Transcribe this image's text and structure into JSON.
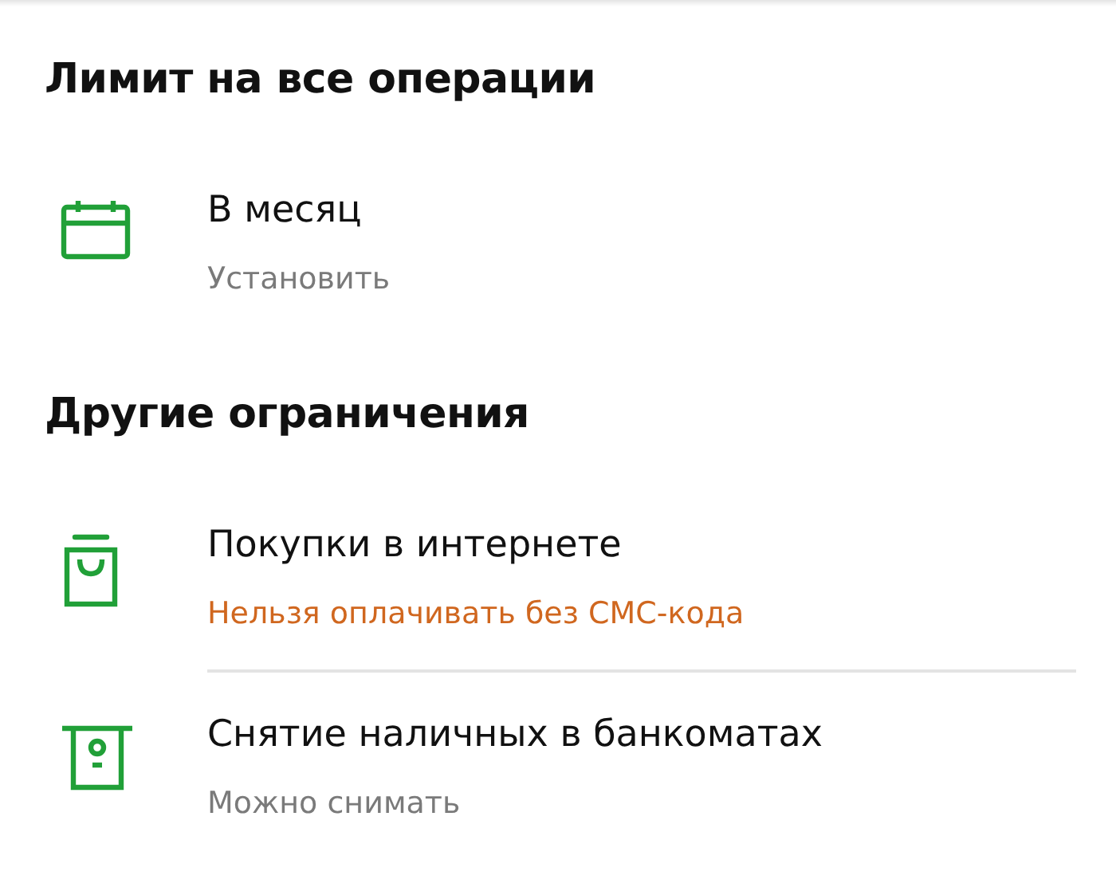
{
  "sections": [
    {
      "title": "Лимит на все операции",
      "items": [
        {
          "title": "В месяц",
          "status": "Установить",
          "kind": "neutral"
        }
      ]
    },
    {
      "title": "Другие ограничения",
      "items": [
        {
          "title": "Покупки в интернете",
          "status": "Нельзя оплачивать без СМС-кода",
          "kind": "warning"
        },
        {
          "title": "Снятие наличных в банкоматах",
          "status": "Можно снимать",
          "kind": "neutral"
        }
      ]
    }
  ]
}
